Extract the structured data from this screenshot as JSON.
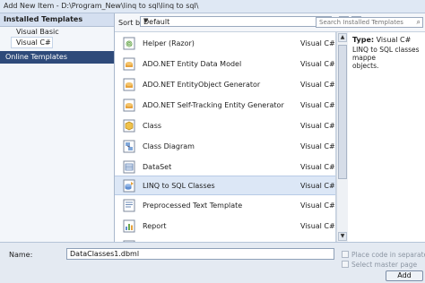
{
  "window": {
    "title": "Add New Item - D:\\Program_New\\linq to sql\\linq to sql\\"
  },
  "left_panel": {
    "header": "Installed Templates",
    "items": [
      {
        "label": "Visual Basic"
      },
      {
        "label": "Visual C#"
      }
    ],
    "online": "Online Templates"
  },
  "toolbar": {
    "sort_label": "Sort by:",
    "sort_value": "Default",
    "search_placeholder": "Search Installed Templates"
  },
  "templates": [
    {
      "name": "Helper (Razor)",
      "lang": "Visual C#",
      "icon": "razor-helper-icon"
    },
    {
      "name": "ADO.NET Entity Data Model",
      "lang": "Visual C#",
      "icon": "entity-data-model-icon"
    },
    {
      "name": "ADO.NET EntityObject Generator",
      "lang": "Visual C#",
      "icon": "entity-generator-icon"
    },
    {
      "name": "ADO.NET Self-Tracking Entity Generator",
      "lang": "Visual C#",
      "icon": "self-tracking-generator-icon"
    },
    {
      "name": "Class",
      "lang": "Visual C#",
      "icon": "class-icon"
    },
    {
      "name": "Class Diagram",
      "lang": "Visual C#",
      "icon": "class-diagram-icon"
    },
    {
      "name": "DataSet",
      "lang": "Visual C#",
      "icon": "dataset-icon"
    },
    {
      "name": "LINQ to SQL Classes",
      "lang": "Visual C#",
      "icon": "linq-to-sql-icon",
      "selected": true
    },
    {
      "name": "Preprocessed Text Template",
      "lang": "Visual C#",
      "icon": "text-template-icon"
    },
    {
      "name": "Report",
      "lang": "Visual C#",
      "icon": "report-icon"
    }
  ],
  "info": {
    "type_label": "Type:",
    "type_value": "Visual C#",
    "description": "LINQ to SQL classes mappe\nobjects."
  },
  "bottom": {
    "name_label": "Name:",
    "name_value": "DataClasses1.dbml",
    "place_code_label": "Place code in separate file",
    "master_page_label": "Select master page",
    "add_button": "Add"
  }
}
